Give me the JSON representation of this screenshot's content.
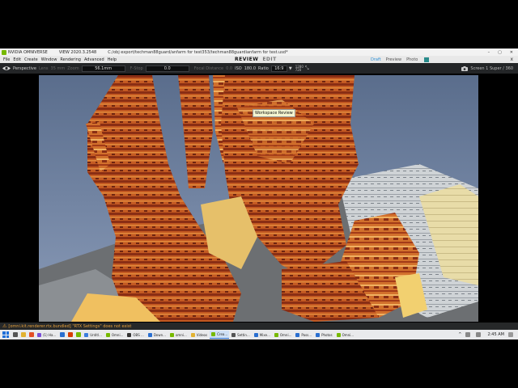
{
  "titlebar": {
    "app_name": "NVIDIA OMNIVERSE",
    "view_version": "VIEW 2020.3.2548",
    "file_path": "C:/obj export/techman88guard/anfarm for test353/techman88guardianfarm for test.usd*",
    "controls": [
      "–",
      "▢",
      "✕"
    ]
  },
  "menubar": {
    "items": [
      "File",
      "Edit",
      "Create",
      "Window",
      "Rendering",
      "Advanced",
      "Help"
    ],
    "center_tabs": [
      "REVIEW",
      "EDIT"
    ],
    "active_center_tab": "REVIEW",
    "mode_tabs": [
      "Draft",
      "Preview",
      "Photo"
    ],
    "active_mode_tab": "Draft",
    "close": "x"
  },
  "tooltip": "Workspace Review",
  "toolbar": {
    "camera_mode": "Perspective",
    "lens_label": "Lens",
    "focal_length": "35 mm",
    "zoom_label": "Zoom",
    "zoom_value": "56.1mm",
    "fstop_label": "F-Stop",
    "fstop_value": "0.0",
    "focal_distance_label": "Focal Distance",
    "focal_distance_value": "0.0",
    "iso_label": "ISO",
    "iso_value": "180.0",
    "ratio_label": "Ratio",
    "ratio_value": "16:9",
    "resolution_w": "1280",
    "resolution_h": "720",
    "screen_label": "Screen 1 Super / 360"
  },
  "status": {
    "warning": "[omni.kit.renderer.rtx.bundled] \"RTX Settings\" does not exist"
  },
  "taskbar": {
    "items": [
      {
        "label": "Untitl...",
        "color": "#3b7ddd"
      },
      {
        "label": "Omni...",
        "color": "#76b900"
      },
      {
        "label": "OBS ...",
        "color": "#333333"
      },
      {
        "label": "Down...",
        "color": "#2a6fd0"
      },
      {
        "label": "omni...",
        "color": "#76b900"
      },
      {
        "label": "Videos",
        "color": "#e2b231"
      },
      {
        "label": "Crea...",
        "color": "#76b900",
        "active": true
      },
      {
        "label": "Settin...",
        "color": "#555555"
      },
      {
        "label": "Mixe...",
        "color": "#2a6fd0"
      },
      {
        "label": "Omni...",
        "color": "#76b900"
      },
      {
        "label": "Pass...",
        "color": "#2a6fd0"
      },
      {
        "label": "Photos",
        "color": "#2a6fd0"
      },
      {
        "label": "Omni...",
        "color": "#76b900"
      }
    ],
    "pinned_left": [
      "#1e6fd9",
      "#555555",
      "#e2b231",
      "#e34f26",
      "#7a4fd8",
      "#2a6fd0",
      "#d83b01",
      "#76b900"
    ],
    "pinned_left_label": "(1) Ha...",
    "clock": "2:45 AM"
  }
}
